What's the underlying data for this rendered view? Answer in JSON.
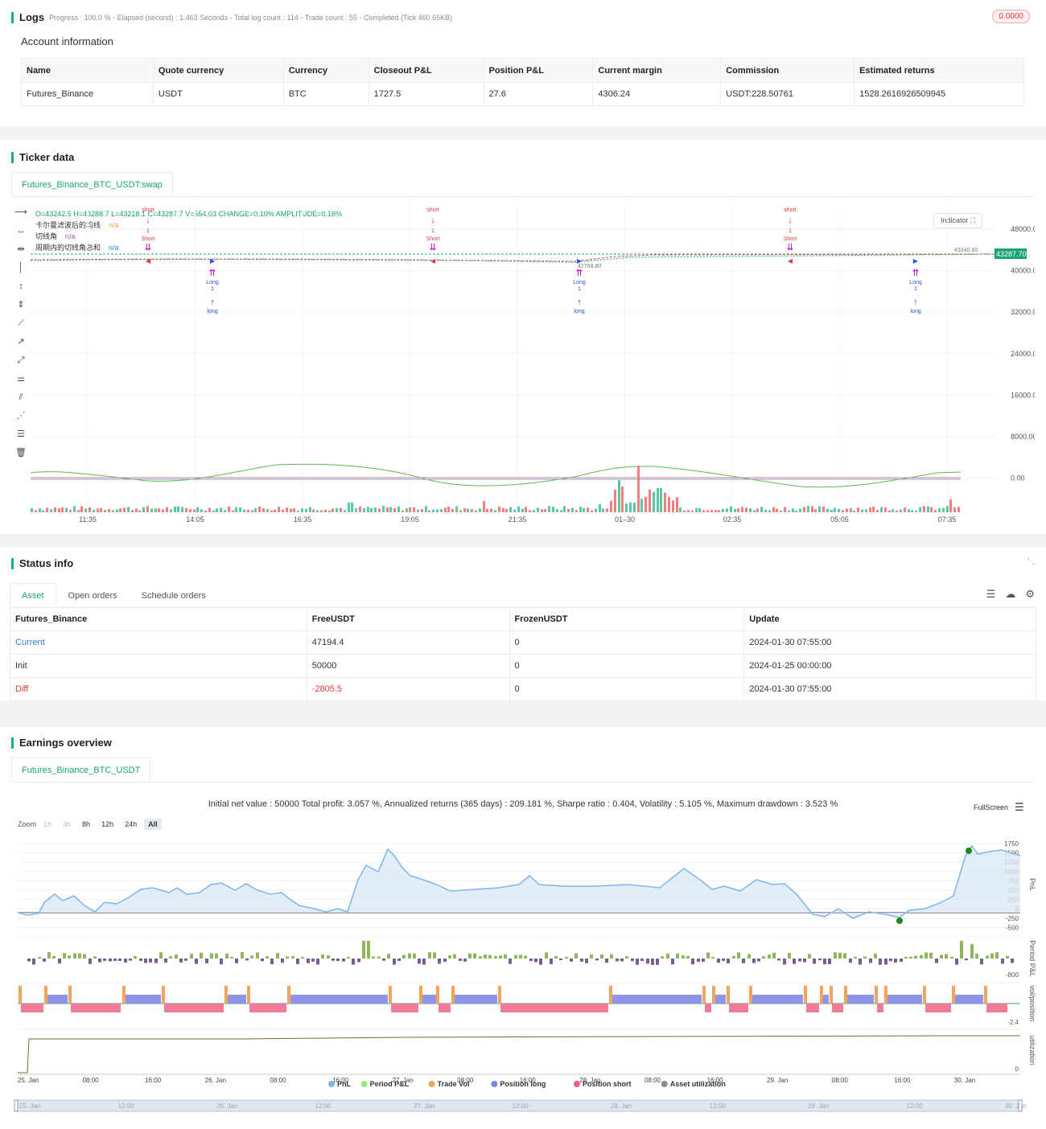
{
  "logs": {
    "title": "Logs",
    "meta": "Progress : 100.0 % - Elapsed (second) : 1.463  Seconds - Total log count : 114 - Trade count : 55 - Completed (Tick 460.65KB)",
    "badge": "0.0000",
    "account_title": "Account information",
    "headers": [
      "Name",
      "Quote currency",
      "Currency",
      "Closeout P&L",
      "Position P&L",
      "Current margin",
      "Commission",
      "Estimated returns"
    ],
    "row": [
      "Futures_Binance",
      "USDT",
      "BTC",
      "1727.5",
      "27.6",
      "4306.24",
      "USDT:228.50761",
      "1528.2616926509945"
    ]
  },
  "ticker": {
    "title": "Ticker data",
    "tab": "Futures_Binance_BTC_USDT:swap",
    "ohlc": "O=43242.5 H=43288.7 L=43218.1 C=43287.7 V=554.03 CHANGE=0.10% AMPLITUDE=0.16%",
    "legend": [
      {
        "label": "卡尔曼滤波后的均线",
        "value": "n/a",
        "color": "#f0a030"
      },
      {
        "label": "切线角",
        "value": "n/a",
        "color": "#9b59b6"
      },
      {
        "label": "周期内的切线角总和",
        "value": "n/a",
        "color": "#2f7ed8"
      }
    ],
    "indicator_btn": "Indicator",
    "y_ticks": [
      "48000.00",
      "40000.00",
      "32000.00",
      "24000.00",
      "16000.00",
      "8000.00",
      "0.00"
    ],
    "x_ticks": [
      "11:35",
      "14:05",
      "16:35",
      "19:05",
      "21:35",
      "01–30",
      "02:35",
      "05:05",
      "07:35"
    ],
    "price_label": "43287.70",
    "price_small": "43340.80",
    "low_label": "42768.80",
    "signals": {
      "short": "short",
      "long": "long",
      "Long": "Long",
      "Short": "Short",
      "one": "1"
    }
  },
  "status": {
    "title": "Status info",
    "tabs": [
      "Asset",
      "Open orders",
      "Schedule orders"
    ],
    "headers": [
      "Futures_Binance",
      "FreeUSDT",
      "FrozenUSDT",
      "Update"
    ],
    "rows": [
      [
        "Current",
        "47194.4",
        "0",
        "2024-01-30 07:55:00"
      ],
      [
        "Init",
        "50000",
        "0",
        "2024-01-25 00:00:00"
      ],
      [
        "Diff",
        "-2805.5",
        "0",
        "2024-01-30 07:55:00"
      ]
    ]
  },
  "earnings": {
    "title": "Earnings overview",
    "tab": "Futures_Binance_BTC_USDT",
    "summary": "Initial net value : 50000 Total profit: 3.057 %, Annualized returns (365 days) : 209.181 %, Sharpe ratio : 0.404, Volatility : 5.105 %, Maximum drawdown : 3.523 %",
    "fullscreen": "FullScreen",
    "zoom_label": "Zoom",
    "zoom": [
      "1h",
      "3h",
      "8h",
      "12h",
      "24h",
      "All"
    ],
    "pnl_ticks": [
      "1750",
      "1500",
      "1250",
      "1000",
      "750",
      "500",
      "250",
      "0",
      "-250",
      "-500"
    ],
    "ppl_ticks": [
      "-800"
    ],
    "vol_ticks": [
      "-2.4"
    ],
    "util_ticks": [
      "0"
    ],
    "axis_titles": [
      "PnL",
      "Period P&L",
      "vol/position",
      "utilization"
    ],
    "x_ticks": [
      "25. Jan",
      "08:00",
      "16:00",
      "26. Jan",
      "08:00",
      "16:00",
      "27. Jan",
      "08:00",
      "16:00",
      "28. Jan",
      "08:00",
      "16:00",
      "29. Jan",
      "08:00",
      "16:00",
      "30. Jan"
    ],
    "nav_ticks": [
      "25. Jan",
      "12:00",
      "26. Jan",
      "12:00",
      "27. Jan",
      "12:00",
      "28. Jan",
      "12:00",
      "29. Jan",
      "12:00",
      "30. Jan"
    ],
    "legend": [
      {
        "label": "PnL",
        "color": "#7cb5ec"
      },
      {
        "label": "Period P&L",
        "color": "#90ed7d"
      },
      {
        "label": "Trade Vol",
        "color": "#f7a35c"
      },
      {
        "label": "Position long",
        "color": "#8085e9"
      },
      {
        "label": "Position short",
        "color": "#f15c80"
      },
      {
        "label": "Asset utilization",
        "color": "#8d8d8d"
      }
    ]
  }
}
